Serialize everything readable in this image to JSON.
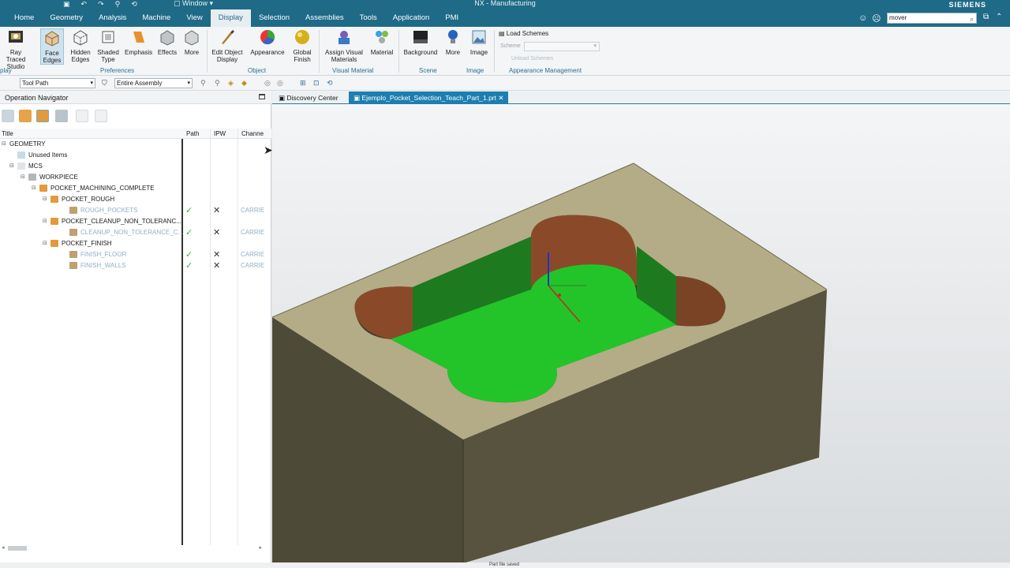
{
  "window": {
    "title": "NX - Manufacturing",
    "window_menu": "Window",
    "brand": "SIEMENS"
  },
  "menu": {
    "tabs": [
      "Home",
      "Geometry",
      "Analysis",
      "Machine",
      "View",
      "Display",
      "Selection",
      "Assemblies",
      "Tools",
      "Application",
      "PMI"
    ],
    "active_tab": "Display",
    "search_value": "mover"
  },
  "ribbon": {
    "buttons": {
      "ray_traced": "Ray Traced Studio",
      "face_edges": "Face Edges",
      "hidden_edges": "Hidden Edges",
      "shaded_type": "Shaded Type",
      "emphasis": "Emphasis",
      "effects": "Effects",
      "more1": "More",
      "edit_object_display": "Edit Object Display",
      "appearance": "Appearance",
      "global_finish": "Global Finish",
      "assign_visual_materials": "Assign Visual Materials",
      "material": "Material",
      "background": "Background",
      "more2": "More",
      "image": "Image",
      "load_schemes": "Load Schemes",
      "scheme_label": "Scheme",
      "unload_schemes": "Unload Schemes"
    },
    "groups": {
      "display": "play",
      "preferences": "Preferences",
      "object": "Object",
      "visual_material": "Visual Material",
      "scene": "Scene",
      "image": "Image",
      "appearance_management": "Appearance Management"
    }
  },
  "toolbar": {
    "filter_value": "Tool Path",
    "scope_value": "Entire Assembly"
  },
  "navigator": {
    "title": "Operation Navigator",
    "columns": {
      "title": "Title",
      "path": "Path",
      "ipw": "IPW",
      "channel": "Channe"
    },
    "rows": [
      {
        "label": "GEOMETRY"
      },
      {
        "label": "Unused Items"
      },
      {
        "label": "MCS"
      },
      {
        "label": "WORKPIECE"
      },
      {
        "label": "POCKET_MACHINING_COMPLETE"
      },
      {
        "label": "POCKET_ROUGH"
      },
      {
        "label": "ROUGH_POCKETS",
        "path": "✓",
        "ipw": "✕",
        "channel": "CARRIE"
      },
      {
        "label": "POCKET_CLEANUP_NON_TOLERANC..."
      },
      {
        "label": "CLEANUP_NON_TOLERANCE_C...",
        "path": "✓",
        "ipw": "✕",
        "channel": "CARRIE"
      },
      {
        "label": "POCKET_FINISH"
      },
      {
        "label": "FINISH_FLOOR",
        "path": "✓",
        "ipw": "✕",
        "channel": "CARRIE"
      },
      {
        "label": "FINISH_WALLS",
        "path": "✓",
        "ipw": "✕",
        "channel": "CARRIE"
      }
    ]
  },
  "graphics": {
    "tabs": [
      "Discovery Center",
      "Ejemplo_Pocket_Selection_Teach_Part_1.prt"
    ],
    "active_tab_index": 1,
    "colors": {
      "block_top": "#b3ac86",
      "block_side_left": "#4d4a38",
      "block_side_right": "#57533e",
      "pocket_floor": "#22c42a",
      "pocket_wall": "#1d7a1f",
      "corner_wall": "#8a4a2a"
    }
  },
  "status": {
    "message": "Part file saved"
  }
}
